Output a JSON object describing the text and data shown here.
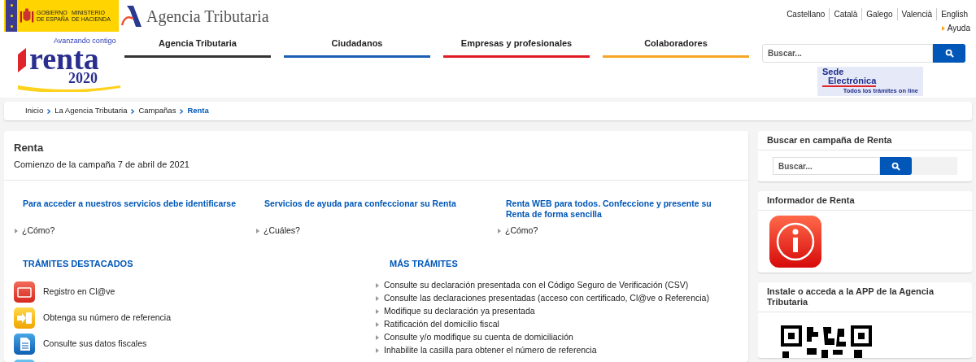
{
  "header": {
    "gov_logo": {
      "line_1": "GOBIERNO DE ESPAÑA",
      "line_2": "MINISTERIO DE HACIENDA"
    },
    "agency_logo": {
      "text": "Agencia Tributaria"
    },
    "languages": [
      "Castellano",
      "Català",
      "Galego",
      "Valencià",
      "English"
    ],
    "help_link": "Ayuda",
    "campaign_logo": {
      "tagline": "Avanzando contigo",
      "word": "renta",
      "year": "2020"
    },
    "nav": [
      {
        "label": "Agencia Tributaria",
        "color": "#333333"
      },
      {
        "label": "Ciudadanos",
        "color": "#1a5fb4"
      },
      {
        "label": "Empresas y profesionales",
        "color": "#e01b24"
      },
      {
        "label": "Colaboradores",
        "color": "#f5a623"
      }
    ],
    "search": {
      "placeholder": "Buscar..."
    },
    "sede_banner": {
      "line_1": "Sede",
      "line_2": "Electrónica",
      "line_3": "Todos los trámites on line"
    }
  },
  "breadcrumb": [
    {
      "label": "Inicio",
      "current": false
    },
    {
      "label": "La Agencia Tributaria",
      "current": false
    },
    {
      "label": "Campañas",
      "current": false
    },
    {
      "label": "Renta",
      "current": true
    }
  ],
  "main": {
    "title": "Renta",
    "subtitle": "Comienzo de la campaña 7 de abril de 2021",
    "services": [
      {
        "heading": "Para acceder a nuestros servicios debe identificarse",
        "link": "¿Cómo?"
      },
      {
        "heading": "Servicios de ayuda para confeccionar su Renta",
        "link": "¿Cuáles?"
      },
      {
        "heading": "Renta WEB para todos. Confeccione y presente su Renta de forma sencilla",
        "link": "¿Cómo?"
      }
    ],
    "featured": {
      "heading": "TRÁMITES DESTACADOS",
      "items": [
        {
          "kind": "pin",
          "label": "Registro en Cl@ve"
        },
        {
          "kind": "phone",
          "label": "Obtenga su número de referencia"
        },
        {
          "kind": "document",
          "label": "Consulte sus datos fiscales"
        },
        {
          "kind": "partial"
        }
      ]
    },
    "more": {
      "heading": "MÁS TRÁMITES",
      "items": [
        "Consulte su declaración presentada con el Código Seguro de Verificación (CSV)",
        "Consulte las declaraciones presentadas (acceso con certificado, Cl@ve o Referencia)",
        "Modifique su declaración ya presentada",
        "Ratificación del domicilio fiscal",
        "Consulte y/o modifique su cuenta de domiciliación",
        "Inhabilite la casilla para obtener el número de referencia"
      ]
    }
  },
  "sidebar": [
    {
      "kind": "search",
      "title": "Buscar en campaña de Renta",
      "placeholder": "Buscar..."
    },
    {
      "kind": "informer",
      "title": "Informador de Renta"
    },
    {
      "kind": "app",
      "title": "Instale o acceda a la APP de la Agencia Tributaria"
    }
  ]
}
